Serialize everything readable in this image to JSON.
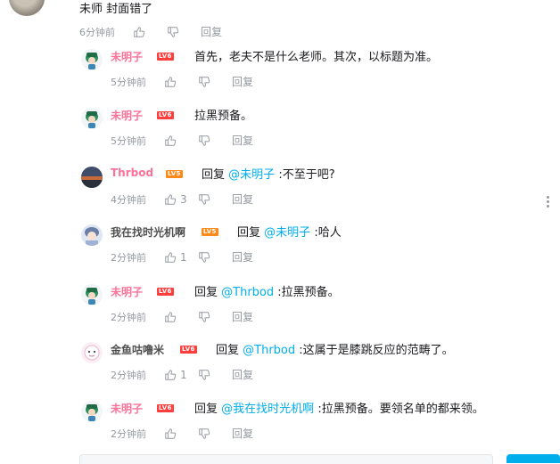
{
  "top_comment": {
    "text": "未师 封面错了",
    "time": "6分钟前",
    "reply_label": "回复"
  },
  "replies": [
    {
      "username": "未明子",
      "level": "LV6",
      "content": "首先，老夫不是什么老师。其次，以标题为准。",
      "reply_prefix": "",
      "mention": "",
      "after_mention": "",
      "time": "5分钟前",
      "likes": "",
      "reply_label": "回复",
      "avatar": "green-cap-avatar"
    },
    {
      "username": "未明子",
      "level": "LV6",
      "content": "拉黑预备。",
      "reply_prefix": "",
      "mention": "",
      "after_mention": "",
      "time": "5分钟前",
      "likes": "",
      "reply_label": "回复",
      "avatar": "green-cap-avatar"
    },
    {
      "username": "Thrbod",
      "level": "LV5",
      "content": "",
      "reply_prefix": "回复",
      "mention": "@未明子",
      "after_mention": ":不至于吧?",
      "time": "4分钟前",
      "likes": "3",
      "reply_label": "回复",
      "avatar": "sunset-avatar"
    },
    {
      "username": "我在找时光机啊",
      "level": "LV5",
      "content": "",
      "reply_prefix": "回复",
      "mention": "@未明子",
      "after_mention": ":哈人",
      "time": "2分钟前",
      "likes": "1",
      "reply_label": "回复",
      "avatar": "anime-avatar"
    },
    {
      "username": "未明子",
      "level": "LV6",
      "content": "",
      "reply_prefix": "回复",
      "mention": "@Thrbod",
      "after_mention": ":拉黑预备。",
      "time": "2分钟前",
      "likes": "",
      "reply_label": "回复",
      "avatar": "green-cap-avatar"
    },
    {
      "username": "金鱼咕噜米",
      "level": "LV6",
      "content": "",
      "reply_prefix": "回复",
      "mention": "@Thrbod",
      "after_mention": ":这属于是膝跳反应的范畴了。",
      "time": "2分钟前",
      "likes": "1",
      "reply_label": "回复",
      "avatar": "cartoon-avatar"
    },
    {
      "username": "未明子",
      "level": "LV6",
      "content": "",
      "reply_prefix": "回复",
      "mention": "@我在找时光机啊",
      "after_mention": ":拉黑预备。要领名单的都来领。",
      "time": "2分钟前",
      "likes": "",
      "reply_label": "回复",
      "avatar": "green-cap-avatar"
    }
  ]
}
